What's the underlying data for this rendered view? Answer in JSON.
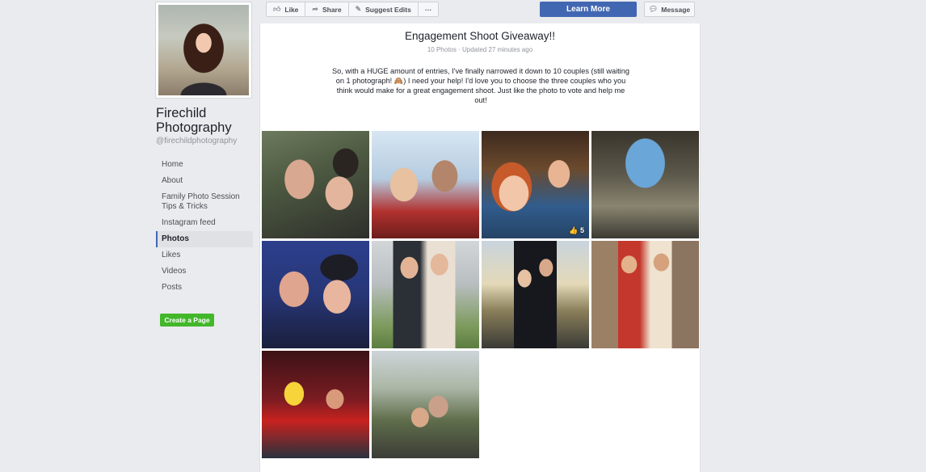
{
  "sidebar": {
    "page_name": "Firechild Photography",
    "handle": "@firechildphotography",
    "nav": [
      {
        "label": "Home",
        "active": false
      },
      {
        "label": "About",
        "active": false
      },
      {
        "label": "Family Photo Session Tips & Tricks",
        "active": false
      },
      {
        "label": "Instagram feed",
        "active": false
      },
      {
        "label": "Photos",
        "active": true
      },
      {
        "label": "Likes",
        "active": false
      },
      {
        "label": "Videos",
        "active": false
      },
      {
        "label": "Posts",
        "active": false
      }
    ],
    "create_page_label": "Create a Page"
  },
  "action_bar": {
    "like_label": "Like",
    "like_icon": "thumbs-up-icon",
    "share_label": "Share",
    "share_icon": "share-arrow-icon",
    "suggest_label": "Suggest Edits",
    "suggest_icon": "pencil-icon",
    "more_label": "···",
    "learn_more_label": "Learn More",
    "message_label": "Message",
    "message_icon": "chat-bubble-icon"
  },
  "album": {
    "title": "Engagement Shoot Giveaway!!",
    "meta": "10 Photos · Updated 27 minutes ago",
    "description": "So, with a HUGE amount of entries, I've finally narrowed it down to 10 couples (still waiting on 1 photograph! 🙈) I need your help! I'd love you to choose the three couples who you think would make for a great engagement shoot. Just like the photo to vote and help me out!",
    "photos": [
      {
        "id": "p1",
        "likes": ""
      },
      {
        "id": "p2",
        "likes": ""
      },
      {
        "id": "p3",
        "likes": "👍 5"
      },
      {
        "id": "p4",
        "likes": ""
      },
      {
        "id": "p5",
        "likes": ""
      },
      {
        "id": "p6",
        "likes": ""
      },
      {
        "id": "p7",
        "likes": ""
      },
      {
        "id": "p8",
        "likes": ""
      },
      {
        "id": "p9",
        "likes": ""
      },
      {
        "id": "p10",
        "likes": ""
      }
    ]
  },
  "colors": {
    "background": "#e9ebee",
    "brand_blue": "#4267b2",
    "create_green": "#42b72a"
  }
}
